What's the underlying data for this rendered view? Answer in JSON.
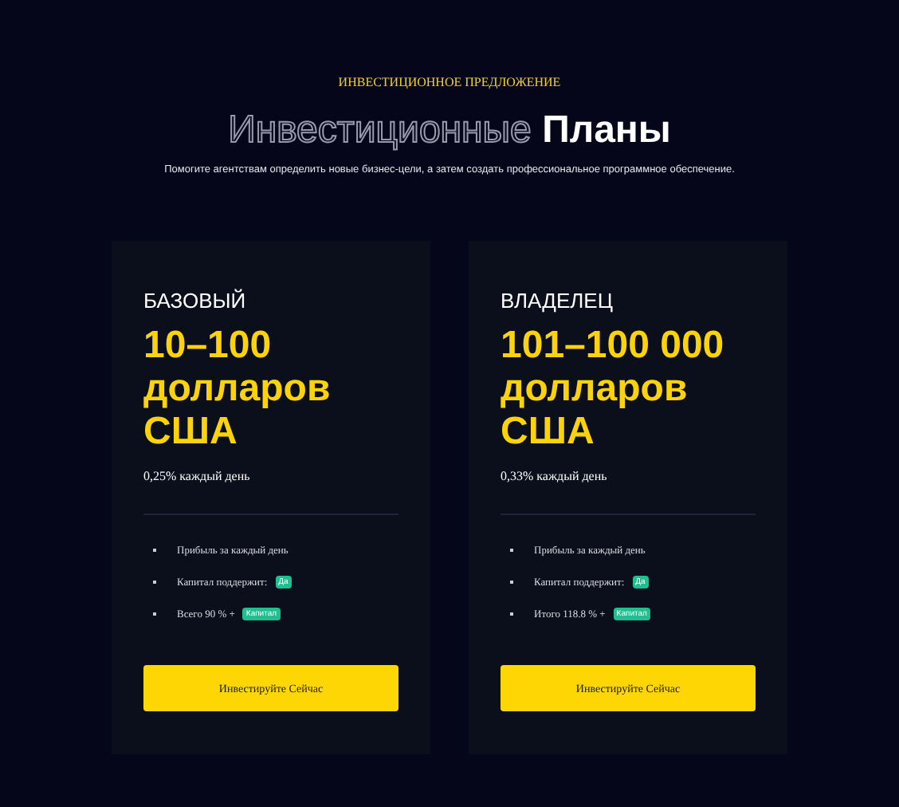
{
  "eyebrow": "ИНВЕСТИЦИОННОЕ ПРЕДЛОЖЕНИЕ",
  "title": {
    "outlined": "Инвестиционные",
    "filled": "Планы"
  },
  "subtitle": "Помогите агентствам определить новые бизнес-цели, а затем создать профессиональное программное обеспечение.",
  "plans": [
    {
      "name": "БАЗОВЫЙ",
      "amount": "10–100",
      "currency": "долларов США",
      "rate": "0,25% каждый день",
      "features": [
        {
          "text": "Прибыль за каждый день"
        },
        {
          "text": "Капитал поддержит:",
          "badge": "Да"
        },
        {
          "text": "Всего 90 % +",
          "badge": "Капитал"
        }
      ],
      "button": "Инвестируйте Сейчас"
    },
    {
      "name": "ВЛАДЕЛЕЦ",
      "amount": "101–100 000",
      "currency": "долларов США",
      "rate": "0,33% каждый день",
      "features": [
        {
          "text": "Прибыль за каждый день"
        },
        {
          "text": "Капитал поддержит:",
          "badge": "Да"
        },
        {
          "text": "Итого 118.8 % +",
          "badge": "Капитал"
        }
      ],
      "button": "Инвестируйте Сейчас"
    }
  ]
}
